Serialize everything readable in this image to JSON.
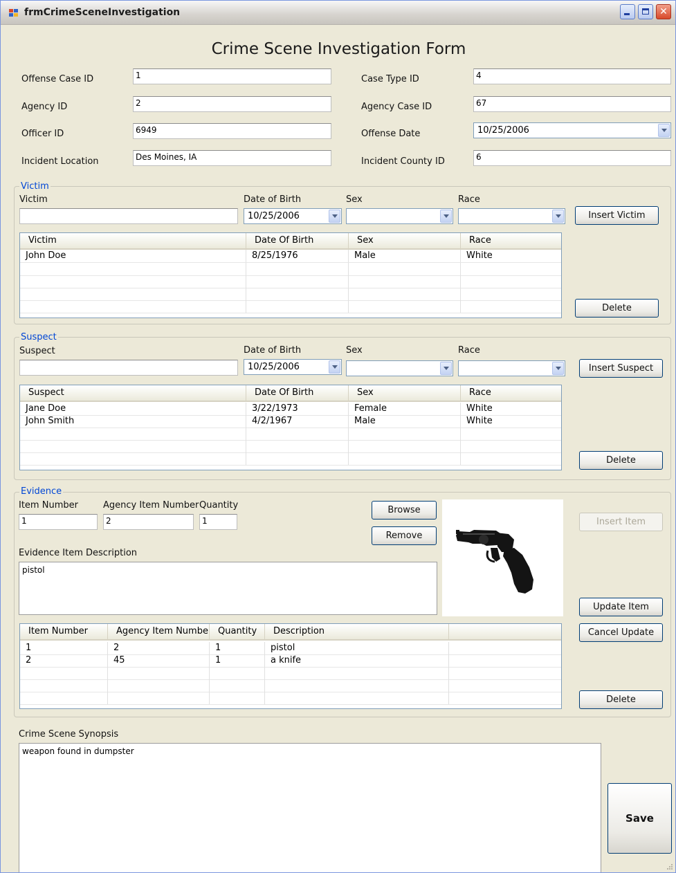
{
  "window": {
    "title": "frmCrimeSceneInvestigation"
  },
  "form": {
    "title": "Crime Scene Investigation Form",
    "fields": {
      "offense_case_id": {
        "label": "Offense Case ID",
        "value": "1"
      },
      "agency_id": {
        "label": "Agency ID",
        "value": "2"
      },
      "officer_id": {
        "label": "Officer ID",
        "value": "6949"
      },
      "incident_location": {
        "label": "Incident Location",
        "value": "Des Moines, IA"
      },
      "case_type_id": {
        "label": "Case Type ID",
        "value": "4"
      },
      "agency_case_id": {
        "label": "Agency Case ID",
        "value": "67"
      },
      "offense_date": {
        "label": "Offense Date",
        "value": "10/25/2006"
      },
      "incident_county_id": {
        "label": "Incident County ID",
        "value": "6"
      }
    }
  },
  "victim": {
    "legend": "Victim",
    "name_label": "Victim",
    "name_value": "",
    "dob_label": "Date of Birth",
    "dob_value": "10/25/2006",
    "sex_label": "Sex",
    "sex_value": "",
    "race_label": "Race",
    "race_value": "",
    "insert_label": "Insert Victim",
    "delete_label": "Delete",
    "columns": [
      "Victim",
      "Date Of Birth",
      "Sex",
      "Race"
    ],
    "rows": [
      [
        "John Doe",
        "8/25/1976",
        "Male",
        "White"
      ]
    ]
  },
  "suspect": {
    "legend": "Suspect",
    "name_label": "Suspect",
    "name_value": "",
    "dob_label": "Date of Birth",
    "dob_value": "10/25/2006",
    "sex_label": "Sex",
    "sex_value": "",
    "race_label": "Race",
    "race_value": "",
    "insert_label": "Insert Suspect",
    "delete_label": "Delete",
    "columns": [
      "Suspect",
      "Date Of Birth",
      "Sex",
      "Race"
    ],
    "rows": [
      [
        "Jane Doe",
        "3/22/1973",
        "Female",
        "White"
      ],
      [
        "John Smith",
        "4/2/1967",
        "Male",
        "White"
      ]
    ]
  },
  "evidence": {
    "legend": "Evidence",
    "item_number_label": "Item Number",
    "item_number_value": "1",
    "agency_item_label": "Agency Item Number",
    "agency_item_value": "2",
    "quantity_label": "Quantity",
    "quantity_value": "1",
    "browse_label": "Browse",
    "remove_label": "Remove",
    "description_label": "Evidence Item Description",
    "description_value": "pistol",
    "insert_label": "Insert Item",
    "update_label": "Update Item",
    "cancel_label": "Cancel Update",
    "delete_label": "Delete",
    "columns": [
      "Item Number",
      "Agency Item Number",
      "Quantity",
      "Description"
    ],
    "rows": [
      [
        "1",
        "2",
        "1",
        "pistol"
      ],
      [
        "2",
        "45",
        "1",
        "a knife"
      ]
    ]
  },
  "synopsis": {
    "label": "Crime Scene Synopsis",
    "value": "weapon found in dumpster"
  },
  "save_label": "Save"
}
